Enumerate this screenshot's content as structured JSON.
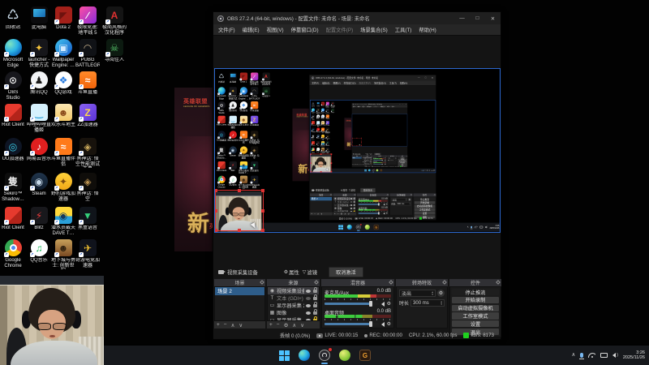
{
  "theme": {
    "accent_blue": "#2c68cf",
    "selection_blue": "#2e5d8a",
    "handle_red": "#e03232",
    "live_green": "#1fd11f",
    "taskbar_underline": "#5aa8e8"
  },
  "desktop": {
    "icons": [
      {
        "label": "回收站",
        "row": 0,
        "col": 0,
        "cls": "bin",
        "glyph": "♺",
        "gc": "#cfe0ee",
        "sc": false
      },
      {
        "label": "此电脑",
        "row": 0,
        "col": 1,
        "cls": "pc",
        "glyph": "",
        "gc": "",
        "sc": false
      },
      {
        "label": "Dota 2",
        "row": 0,
        "col": 2,
        "bg": "#a32019",
        "glyph": "◤",
        "gc": "#6e120e",
        "sc": true
      },
      {
        "label": "极限竞速: 地平线 5",
        "row": 0,
        "col": 3,
        "bg": "linear-gradient(135deg,#ff4fa3,#8a2bd8)",
        "glyph": "∕",
        "gc": "#ffffff",
        "sc": true
      },
      {
        "label": "极简风格的汉化程序",
        "row": 0,
        "col": 4,
        "bg": "#141414",
        "glyph": "A",
        "gc": "#e03131",
        "sc": true
      },
      {
        "label": "Microsoft Edge",
        "row": 1,
        "col": 0,
        "cls": "round",
        "bg": "radial-gradient(circle at 30% 30%,#7fe3c0,#2bb3e6 45%,#0b62b8 80%)",
        "glyph": "",
        "gc": "",
        "sc": true
      },
      {
        "label": "launcher - 快捷方式",
        "row": 1,
        "col": 1,
        "bg": "#16161a",
        "glyph": "✦",
        "gc": "#f5c33b",
        "sc": true
      },
      {
        "label": "Wallpaper Engine: …",
        "row": 1,
        "col": 2,
        "cls": "round",
        "bg": "linear-gradient(135deg,#43c6f0,#1258c8)",
        "glyph": "▣",
        "gc": "#cfeaff",
        "sc": true
      },
      {
        "label": "PUBG BATTLEGR…",
        "row": 1,
        "col": 3,
        "bg": "#101216",
        "glyph": "◠",
        "gc": "#c8b28e",
        "sc": true
      },
      {
        "label": "寻阅佳人",
        "row": 1,
        "col": 4,
        "bg": "#0c1a10",
        "glyph": "☠",
        "gc": "#56c46a",
        "sc": true
      },
      {
        "label": "OBS Studio",
        "row": 2,
        "col": 0,
        "cls": "round",
        "bg": "#17171c",
        "glyph": "⊙",
        "gc": "#ededed",
        "sc": true
      },
      {
        "label": "腾讯QQ",
        "row": 2,
        "col": 1,
        "cls": "round",
        "bg": "#f2f4f6",
        "glyph": "♟",
        "gc": "#1a1a1a",
        "sc": true
      },
      {
        "label": "QQ游戏",
        "row": 2,
        "col": 2,
        "cls": "round",
        "bg": "#ffffff",
        "glyph": "❖",
        "gc": "#2a7de0",
        "sc": true
      },
      {
        "label": "斗鱼直播",
        "row": 2,
        "col": 3,
        "bg": "linear-gradient(180deg,#ff8a2a,#f2640a)",
        "glyph": "≈",
        "gc": "#ffffff",
        "sc": true
      },
      {
        "label": "Riot Client",
        "row": 3,
        "col": 0,
        "bg": "linear-gradient(135deg,#e63a2e 55%,#b3241a 55%)",
        "glyph": "",
        "gc": "",
        "sc": true
      },
      {
        "label": "哔哩哔哩直播姬",
        "row": 3,
        "col": 1,
        "bg": "#d6f1fd",
        "glyph": "‿",
        "gc": "#2a9fd8",
        "sc": true
      },
      {
        "label": "欢乐斗地主",
        "row": 3,
        "col": 2,
        "bg": "linear-gradient(180deg,#fbe7b2,#f3c96a)",
        "glyph": "☻",
        "gc": "#8a4a1a",
        "sc": true
      },
      {
        "label": "ZZ加速器",
        "row": 3,
        "col": 3,
        "bg": "linear-gradient(135deg,#8a63f0,#5c32d8)",
        "glyph": "Z",
        "gc": "#ffd84a",
        "sc": true
      },
      {
        "label": "UU加速器",
        "row": 4,
        "col": 0,
        "cls": "round",
        "bg": "#0e1524",
        "glyph": "◎",
        "gc": "#3ad1f0",
        "sc": true
      },
      {
        "label": "网易云音乐",
        "row": 4,
        "col": 1,
        "cls": "round",
        "bg": "#e01f1f",
        "glyph": "♪",
        "gc": "#ffffff",
        "sc": true
      },
      {
        "label": "斗鱼直播伴侣",
        "row": 4,
        "col": 2,
        "bg": "#ff7a1a",
        "glyph": "≈",
        "gc": "#ffffff",
        "sc": true
      },
      {
        "label": "黑神话: 悟空性能测试工具",
        "row": 4,
        "col": 3,
        "bg": "#17120c",
        "glyph": "◈",
        "gc": "#c9a85a",
        "sc": true
      },
      {
        "label": "Sekiro™ Shadow…",
        "row": 5,
        "col": 0,
        "bg": "#0d0d0d",
        "glyph": "隻",
        "gc": "#e8e8e8",
        "sc": true
      },
      {
        "label": "Steam",
        "row": 5,
        "col": 1,
        "cls": "round",
        "bg": "linear-gradient(180deg,#20354c,#0f1b2a)",
        "glyph": "◉",
        "gc": "#c5d8e8",
        "sc": true
      },
      {
        "label": "野豹游戏加速器",
        "row": 5,
        "col": 2,
        "cls": "round",
        "bg": "linear-gradient(180deg,#ffd23a,#f0a818)",
        "glyph": "✦",
        "gc": "#7a4a10",
        "sc": true
      },
      {
        "label": "黑神话: 悟空",
        "row": 5,
        "col": 3,
        "bg": "#0f0d0a",
        "glyph": "◈",
        "gc": "#b89050",
        "sc": true
      },
      {
        "label": "Riot Client",
        "row": 6,
        "col": 0,
        "bg": "linear-gradient(135deg,#e63a2e 55%,#b3241a 55%)",
        "glyph": "",
        "gc": "",
        "sc": true
      },
      {
        "label": "Blitz",
        "row": 6,
        "col": 1,
        "bg": "#18181c",
        "glyph": "⚡",
        "gc": "#e83a3a",
        "sc": true
      },
      {
        "label": "潜水员戴夫 DAVE T…",
        "row": 6,
        "col": 2,
        "bg": "linear-gradient(180deg,#ffd83a 55%,#2a9fd8 55%)",
        "glyph": "◉",
        "gc": "#15395c",
        "sc": true
      },
      {
        "label": "黑盒语音",
        "row": 6,
        "col": 3,
        "bg": "#10141a",
        "glyph": "▼",
        "gc": "#35d07a",
        "sc": true
      },
      {
        "label": "Google Chrome",
        "row": 7,
        "col": 0,
        "cls": "chrome",
        "glyph": "",
        "gc": "",
        "sc": true
      },
      {
        "label": "QQ音乐",
        "row": 7,
        "col": 1,
        "cls": "round",
        "bg": "#ffffff",
        "glyph": "♫",
        "gc": "#18b858",
        "sc": true
      },
      {
        "label": "地下城与勇士: 创新世纪",
        "row": 7,
        "col": 2,
        "bg": "linear-gradient(180deg,#c8a05a,#7a4a22)",
        "glyph": "☻",
        "gc": "#33220f",
        "sc": true
      },
      {
        "label": "奇游电竞加速器",
        "row": 7,
        "col": 3,
        "bg": "#10131c",
        "glyph": "✈",
        "gc": "#f0c030",
        "sc": true
      }
    ]
  },
  "poster": {
    "logo": "英雄联盟",
    "logo_sub": "LEAGUE OF LEGENDS",
    "big": "新",
    "side": "英"
  },
  "obs": {
    "window_title": "OBS 27.2.4 (64-bit, windows) - 配置文件: 未命名 - 场景: 未命名",
    "window_buttons": {
      "min": "—",
      "max": "□",
      "close": "✕"
    },
    "menu": [
      "文件(F)",
      "编辑(E)",
      "视图(V)",
      "停靠窗口(D)",
      "配置文件(P)",
      "场景集合(S)",
      "工具(T)",
      "帮助(H)"
    ],
    "menu_dim_item": "配置文件(P)",
    "source_bar": {
      "source": "视频采集设备",
      "properties": "属性",
      "filters": "滤镜",
      "deactivate": "取消激活"
    },
    "scenes": {
      "title": "场景",
      "items": [
        "场景 2"
      ],
      "toolbar": [
        "+",
        "−",
        "∧",
        "∨"
      ]
    },
    "sources": {
      "title": "来源",
      "toolbar": [
        "+",
        "−",
        "⚙",
        "∧",
        "∨"
      ],
      "items": [
        {
          "name": "视频采集设备",
          "type": "◉",
          "dim": false,
          "lock": "gray",
          "selected": true
        },
        {
          "name": "文本 (GDI+)",
          "type": "T",
          "dim": true,
          "lock": "gray",
          "selected": false
        },
        {
          "name": "显示器采集 2",
          "type": "▭",
          "dim": false,
          "lock": "gray",
          "selected": false
        },
        {
          "name": "图像",
          "type": "▦",
          "dim": false,
          "lock": "gray",
          "selected": false
        },
        {
          "name": "显示器采集",
          "type": "▭",
          "dim": false,
          "lock": "yellow",
          "selected": false
        }
      ]
    },
    "mixer": {
      "title": "混音器",
      "channels": [
        {
          "name": "麦克风/Aux",
          "db": "0.0 dB",
          "meter": "mic"
        },
        {
          "name": "桌面音频",
          "db": "0.0 dB",
          "meter": "desk"
        }
      ]
    },
    "transitions": {
      "title": "转场特效",
      "value": "淡出",
      "duration_label": "时长",
      "duration_value": "300 ms"
    },
    "controls": {
      "title": "控件",
      "active_button": "停止推流",
      "buttons": [
        "停止推流",
        "开始录制",
        "启动虚拟摄像机",
        "工作室模式",
        "设置",
        "退出"
      ]
    },
    "status": {
      "dropped": "丢帧 0 (0.0%)",
      "live": "LIVE: 00:00:15",
      "rec": "REC: 00:00:00",
      "cpu": "CPU: 2.1%, 60.00 fps",
      "bitrate": "kb/s: 8173"
    }
  },
  "taskbar": {
    "center_items": [
      {
        "name": "start"
      },
      {
        "name": "edge"
      },
      {
        "name": "obs",
        "running": true,
        "notification": true
      },
      {
        "name": "media-app"
      },
      {
        "name": "game-app",
        "glyph": "G"
      }
    ],
    "clock": {
      "time": "3:26",
      "date": "2025/11/26"
    }
  }
}
